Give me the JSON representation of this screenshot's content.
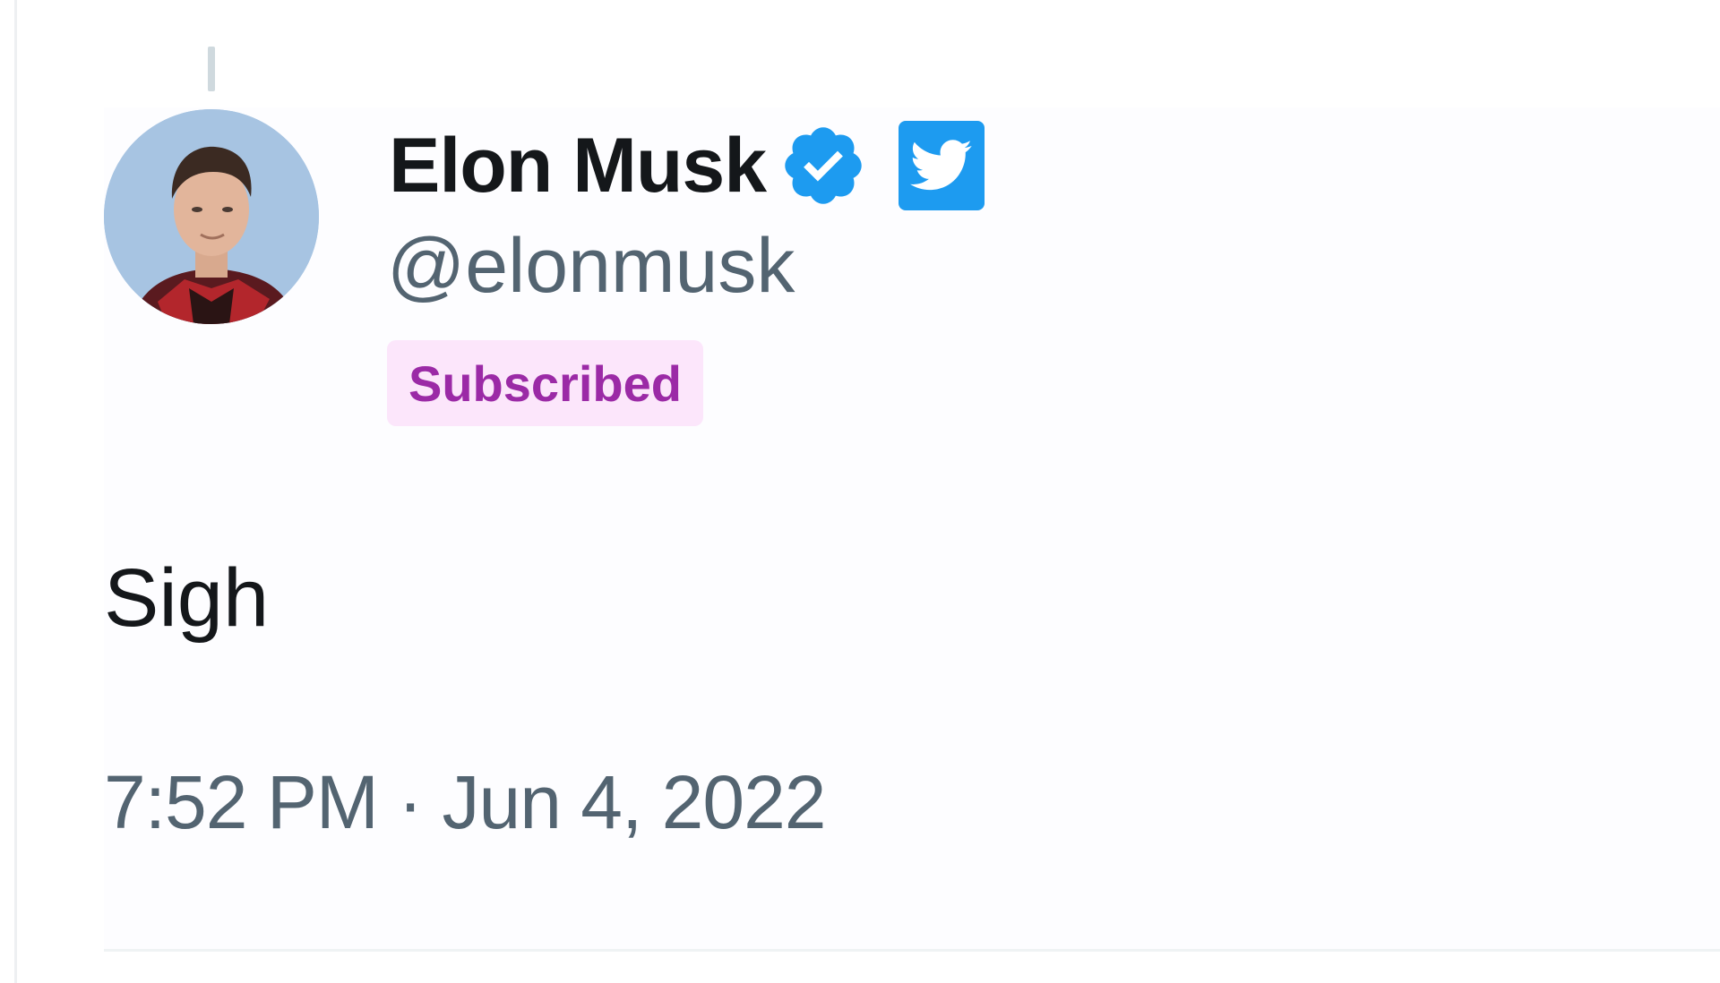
{
  "tweet": {
    "author": {
      "display_name": "Elon Musk",
      "handle": "@elonmusk",
      "verified_icon": "verified-badge-icon",
      "affiliation_icon": "twitter-bird-icon",
      "subscription_badge": "Subscribed"
    },
    "text": "Sigh",
    "timestamp": "7:52 PM · Jun 4, 2022"
  },
  "colors": {
    "verified_blue": "#1d9bf0",
    "name_text": "#14171a",
    "secondary_text": "#536471",
    "badge_background": "#fce6fb",
    "badge_text": "#9b2aa6"
  }
}
